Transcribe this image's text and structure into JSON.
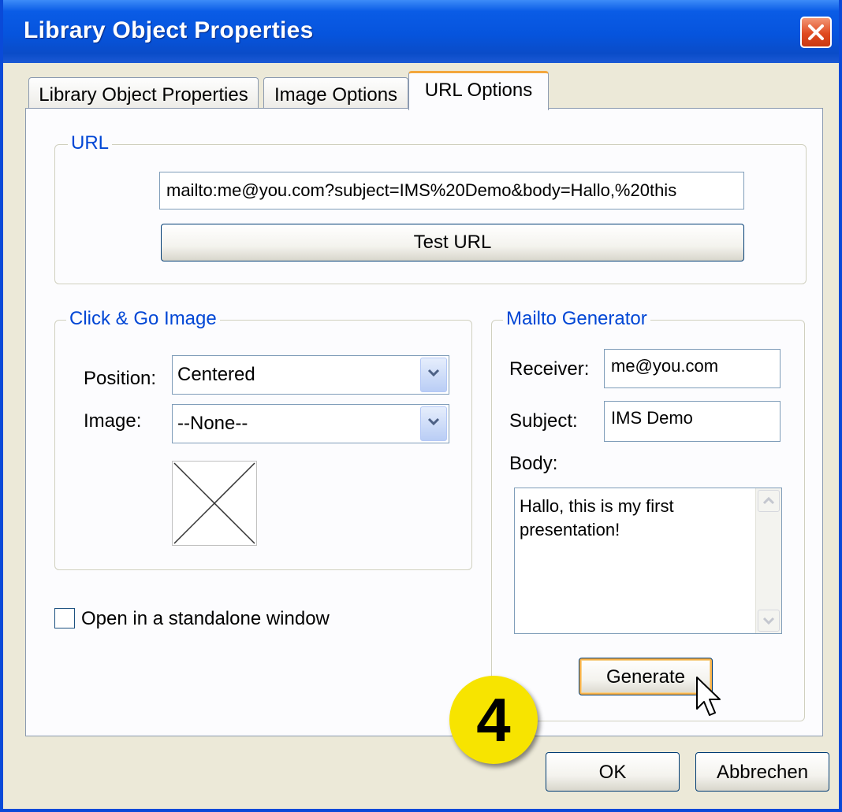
{
  "window": {
    "title": "Library Object Properties"
  },
  "tabs": [
    {
      "label": "Library Object Properties",
      "active": false
    },
    {
      "label": "Image Options",
      "active": false
    },
    {
      "label": "URL Options",
      "active": true
    }
  ],
  "url_group": {
    "legend": "URL",
    "url_value": "mailto:me@you.com?subject=IMS%20Demo&body=Hallo,%20this",
    "test_button": "Test URL"
  },
  "click_go_group": {
    "legend": "Click & Go Image",
    "position_label": "Position:",
    "position_value": "Centered",
    "image_label": "Image:",
    "image_value": "--None--"
  },
  "standalone_checkbox": {
    "label": "Open in a standalone window",
    "checked": false
  },
  "mailto_group": {
    "legend": "Mailto Generator",
    "receiver_label": "Receiver:",
    "receiver_value": "me@you.com",
    "subject_label": "Subject:",
    "subject_value": "IMS Demo",
    "body_label": "Body:",
    "body_line1": "Hallo, this is my first",
    "body_line2": "presentation!",
    "generate_button": "Generate"
  },
  "step_badge": "4",
  "footer": {
    "ok_button": "OK",
    "cancel_button": "Abbrechen"
  },
  "colors": {
    "titlebar": "#0654dd",
    "group_legend": "#0046d5",
    "focus_ring": "#f9b24a",
    "badge": "#f7e400"
  }
}
